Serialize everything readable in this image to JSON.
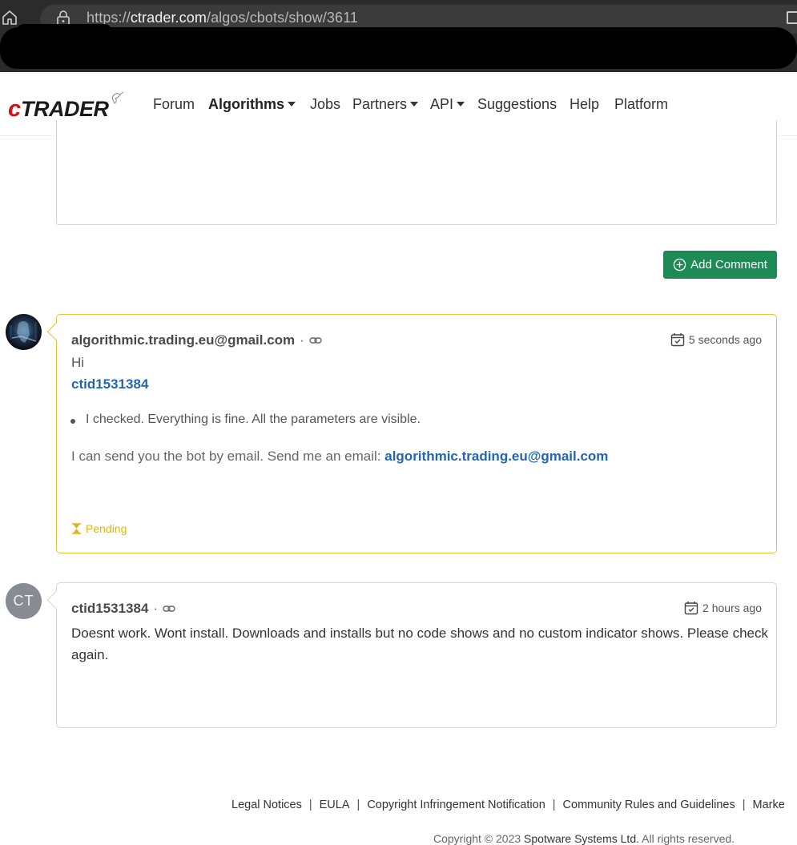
{
  "browser": {
    "url_prefix": "https://",
    "url_host": "ctrader.com",
    "url_path": "/algos/cbots/show/3611"
  },
  "nav": {
    "logo_text": "cTRADER",
    "items": [
      {
        "label": "Forum",
        "dropdown": false,
        "active": false
      },
      {
        "label": "Algorithms",
        "dropdown": true,
        "active": true
      },
      {
        "label": "Jobs",
        "dropdown": false,
        "active": false
      },
      {
        "label": "Partners",
        "dropdown": true,
        "active": false
      },
      {
        "label": "API",
        "dropdown": true,
        "active": false
      },
      {
        "label": "Suggestions",
        "dropdown": false,
        "active": false
      },
      {
        "label": "Help",
        "dropdown": false,
        "active": false
      },
      {
        "label": "Platform",
        "dropdown": false,
        "active": false
      }
    ]
  },
  "add_comment": {
    "label": "Add Comment"
  },
  "comments": [
    {
      "author": "algorithmic.trading.eu@gmail.com",
      "time": "5 seconds ago",
      "greeting": "Hi",
      "mention": "ctid1531384",
      "bullet": "I checked. Everything is fine. All the parameters are visible.",
      "email_text": "I can send you the bot by email. Send me an email:",
      "email_link": "algorithmic.trading.eu@gmail.com",
      "status": "Pending"
    },
    {
      "author": "ctid1531384",
      "avatar_initials": "CT",
      "time": "2 hours ago",
      "body": "Doesnt work. Wont install. Downloads and installs but no code shows and no custom indicator shows. Please check again."
    }
  ],
  "footer": {
    "links": [
      "Legal Notices",
      "EULA",
      "Copyright Infringement Notification",
      "Community Rules and Guidelines",
      "Marke"
    ],
    "separator": "|",
    "copyright_prefix": "Copyright © 2023",
    "company": "Spotware Systems Ltd.",
    "copyright_suffix": "All rights reserved."
  },
  "colors": {
    "accent_green": "#1e8a55",
    "link_blue": "#2166b5",
    "pending_yellow": "#e0b51c",
    "logo_red": "#d0121b"
  }
}
